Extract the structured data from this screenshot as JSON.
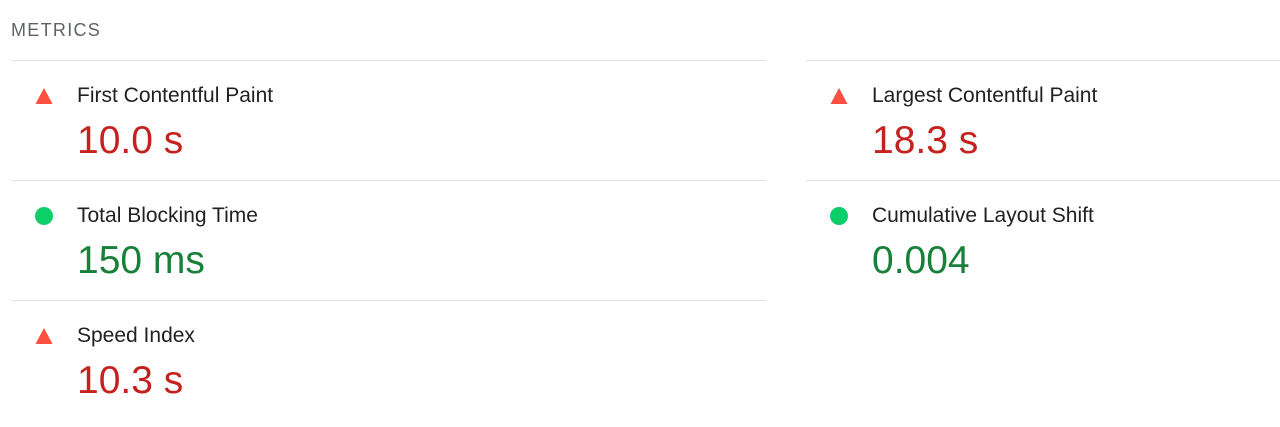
{
  "header": {
    "title": "METRICS"
  },
  "colors": {
    "fail_icon": "#ff4e42",
    "fail_text": "#c5221f",
    "pass_icon": "#0cce6b",
    "pass_text": "#188038",
    "divider": "#e0e0e0"
  },
  "metrics": [
    {
      "title": "First Contentful Paint",
      "value": "10.0 s",
      "status": "fail",
      "icon": "triangle-icon"
    },
    {
      "title": "Largest Contentful Paint",
      "value": "18.3 s",
      "status": "fail",
      "icon": "triangle-icon"
    },
    {
      "title": "Total Blocking Time",
      "value": "150 ms",
      "status": "pass",
      "icon": "circle-icon"
    },
    {
      "title": "Cumulative Layout Shift",
      "value": "0.004",
      "status": "pass",
      "icon": "circle-icon"
    },
    {
      "title": "Speed Index",
      "value": "10.3 s",
      "status": "fail",
      "icon": "triangle-icon"
    }
  ]
}
